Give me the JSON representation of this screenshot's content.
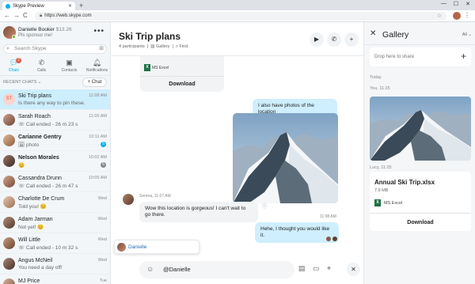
{
  "browser": {
    "tab_title": "Skype Preview",
    "new_tab": "+",
    "url": "https://web.skype.com",
    "win_min": "—",
    "win_max": "☐",
    "win_close": "✕",
    "back": "←",
    "forward": "→",
    "reload": "C",
    "menu": "⋮"
  },
  "me": {
    "name": "Danielle Booker",
    "credit": "$13.26",
    "status": "Pls sponsor me!",
    "more": "•••"
  },
  "search": {
    "placeholder": "Search Skype"
  },
  "navtabs": [
    {
      "label": "Chats",
      "badge": "2",
      "icon": "chat-icon"
    },
    {
      "label": "Calls",
      "icon": "phone-icon"
    },
    {
      "label": "Contacts",
      "icon": "contacts-icon"
    },
    {
      "label": "Notifications",
      "icon": "bell-icon"
    }
  ],
  "recent_header": "RECENT CHATS ⌄",
  "new_chat": "+ Chat",
  "chats": [
    {
      "name": "Ski Trip plans",
      "preview": "Is there any way to pin these...",
      "time": "11:08 AM",
      "initials": "ST"
    },
    {
      "name": "Sarah Roach",
      "preview": "☏ Call ended - 26 m 23 s",
      "time": "11:05 AM"
    },
    {
      "name": "Carianne Gentry",
      "preview": "🖼 photo",
      "time": "10:11 AM",
      "badge": "5"
    },
    {
      "name": "Nelson Morales",
      "preview": "😊",
      "time": "10:02 AM",
      "badge": "6"
    },
    {
      "name": "Cassandra Drunn",
      "preview": "☏ Call ended - 26 m 47 s",
      "time": "10:05 AM"
    },
    {
      "name": "Charlotte De Crum",
      "preview": "Told you! 😊",
      "time": "Wed"
    },
    {
      "name": "Adam Jarman",
      "preview": "Not yet! 😊",
      "time": "Wed"
    },
    {
      "name": "Will Little",
      "preview": "☏ Call ended - 10 m 32 s",
      "time": "Wed"
    },
    {
      "name": "Angus McNeil",
      "preview": "You need a day off!",
      "time": "Wed"
    },
    {
      "name": "MJ Price",
      "preview": "",
      "time": "Tue"
    }
  ],
  "conversation": {
    "title": "Ski Trip plans",
    "participants": "4 participants",
    "gallery_link": "Gallery",
    "find_link": "Find",
    "file_type": "MS Excel",
    "download": "Download",
    "msg1": "I also have photos of the location",
    "heart_count": "1",
    "sender": "Serena, 11:07 AM",
    "msg2": "Wow this location is gorgeous! I can't wait to go there.",
    "time2": "11:08 AM",
    "msg3": "Hehe, I thought you would like it.",
    "mention": "Danielle",
    "composer_text": "@Danielle"
  },
  "gallery": {
    "title": "Gallery",
    "filter": "All ⌄",
    "drop_text": "Drop here to share",
    "today": "Today",
    "photo_by": "You, 11:25",
    "file_by": "Lucy, 11:25",
    "file_name": "Annual Ski Trip.xlsx",
    "file_size": "7.6 MB",
    "file_type": "MS Excel",
    "download": "Download"
  }
}
